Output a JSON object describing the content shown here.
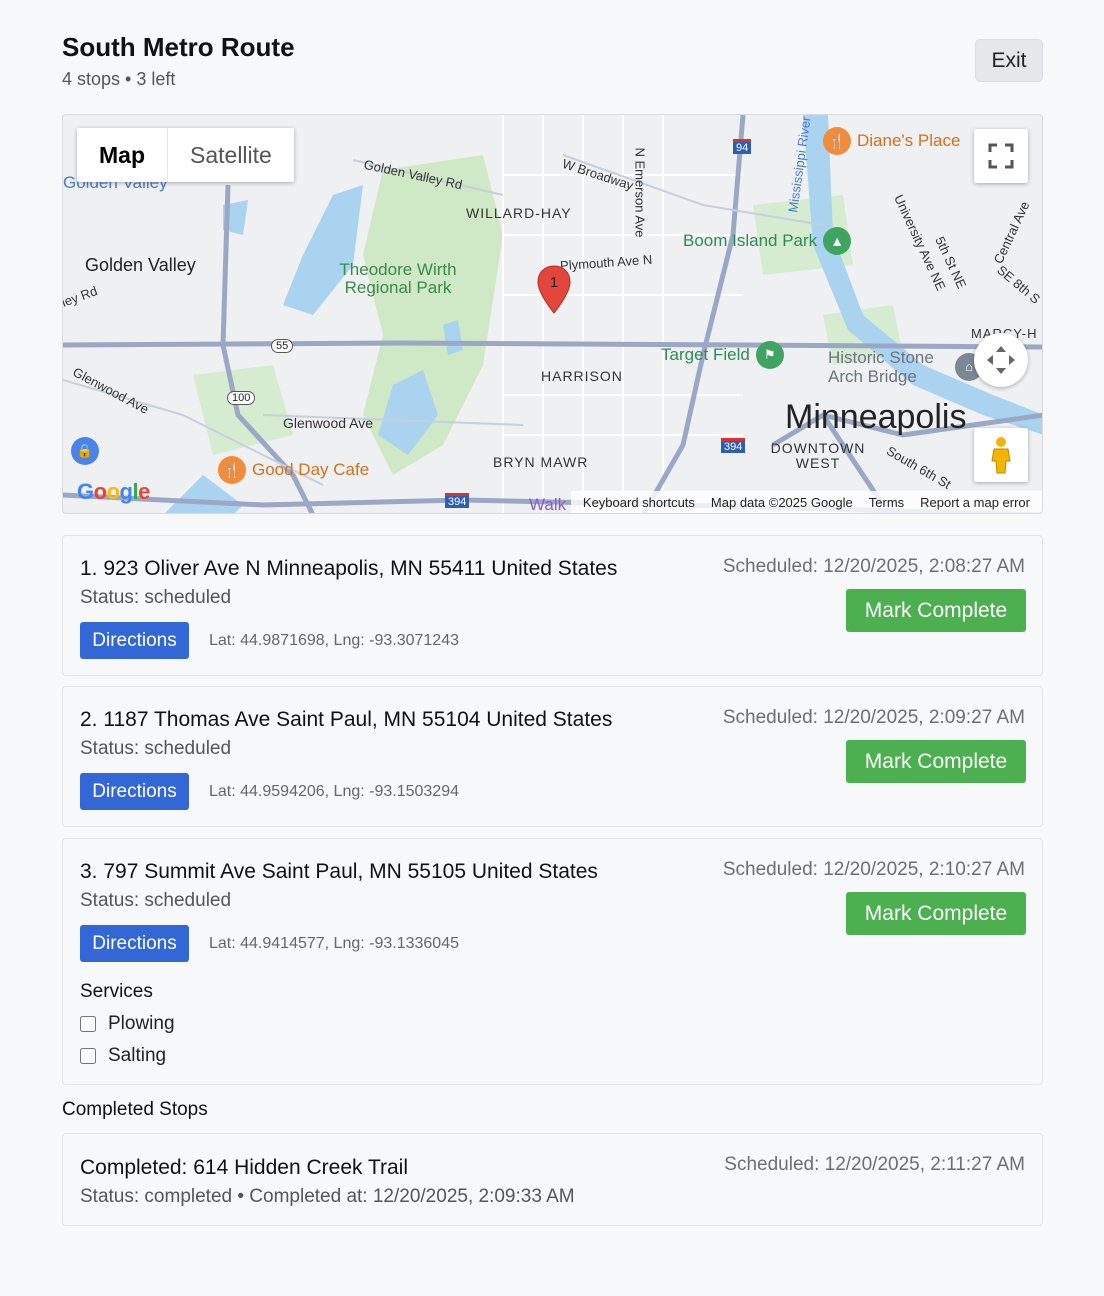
{
  "header": {
    "title": "South Metro Route",
    "subtitle": "4 stops • 3 left",
    "exit_label": "Exit"
  },
  "map": {
    "type_map": "Map",
    "type_satellite": "Satellite",
    "marker_label": "1",
    "labels": {
      "golden_valley_top": "Golden Valley",
      "golden_valley": "Golden Valley",
      "golden_valley_rd": "Golden Valley Rd",
      "broadway": "W Broadway",
      "willard_hay": "WILLARD-HAY",
      "emerson": "N Emerson Ave",
      "mississippi": "Mississippi River",
      "dianes": "Diane's Place",
      "boom_island": "Boom Island Park",
      "university": "University Ave NE",
      "fifth_st": "5th St NE",
      "central": "Central Ave",
      "se8": "SE 8th S",
      "plymouth": "Plymouth Ave N",
      "theodore": "Theodore Wirth Regional Park",
      "ley_rd": "ley Rd",
      "marcy": "MARCY-H",
      "target_field": "Target Field",
      "historic": "Historic Stone Arch Bridge",
      "harrison": "HARRISON",
      "glenwood_ave_l": "Glenwood Ave",
      "glenwood_ave": "Glenwood Ave",
      "minneapolis": "Minneapolis",
      "downtown": "DOWNTOWN WEST",
      "south6": "South 6th St",
      "good_day": "Good Day Cafe",
      "bryn": "BRYN MAWR",
      "walk": "Walk",
      "r55": "55",
      "r100": "100",
      "r94": "94",
      "r394a": "394",
      "r394b": "394"
    },
    "google": "Google",
    "attribution": {
      "shortcuts": "Keyboard shortcuts",
      "data": "Map data ©2025 Google",
      "terms": "Terms",
      "report": "Report a map error"
    }
  },
  "stops": [
    {
      "address": "1. 923 Oliver Ave N Minneapolis, MN 55411 United States",
      "status": "Status: scheduled",
      "scheduled": "Scheduled: 12/20/2025, 2:08:27 AM",
      "complete_label": "Mark Complete",
      "directions_label": "Directions",
      "coords": "Lat: 44.9871698, Lng: -93.3071243"
    },
    {
      "address": "2. 1187 Thomas Ave Saint Paul, MN 55104 United States",
      "status": "Status: scheduled",
      "scheduled": "Scheduled: 12/20/2025, 2:09:27 AM",
      "complete_label": "Mark Complete",
      "directions_label": "Directions",
      "coords": "Lat: 44.9594206, Lng: -93.1503294"
    },
    {
      "address": "3. 797 Summit Ave Saint Paul, MN 55105 United States",
      "status": "Status: scheduled",
      "scheduled": "Scheduled: 12/20/2025, 2:10:27 AM",
      "complete_label": "Mark Complete",
      "directions_label": "Directions",
      "coords": "Lat: 44.9414577, Lng: -93.1336045",
      "services_title": "Services",
      "services": [
        {
          "label": "Plowing",
          "checked": false
        },
        {
          "label": "Salting",
          "checked": false
        }
      ]
    }
  ],
  "completed": {
    "heading": "Completed Stops",
    "title": "Completed: 614 Hidden Creek Trail",
    "status": "Status: completed • Completed at: 12/20/2025, 2:09:33 AM",
    "scheduled": "Scheduled: 12/20/2025, 2:11:27 AM"
  },
  "colors": {
    "accent_blue": "#3367d6",
    "complete_green": "#4caf50",
    "marker_red": "#e2463b",
    "park_green": "#cfe8c6",
    "water_blue": "#a9d3ef"
  }
}
